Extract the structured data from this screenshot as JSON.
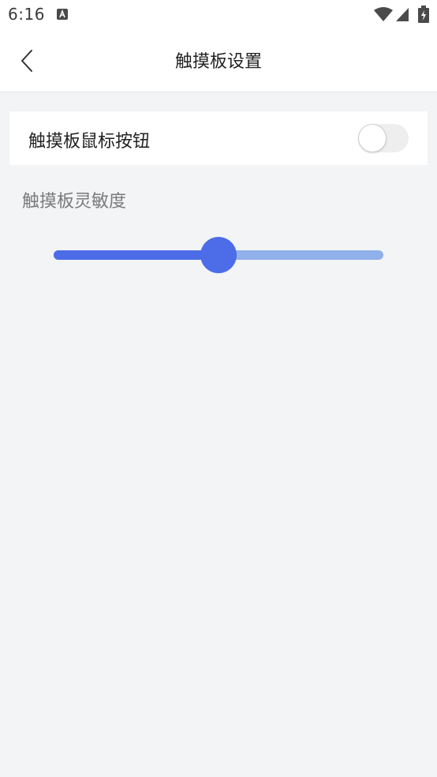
{
  "status_bar": {
    "time": "6:16",
    "icons": [
      "notification-a-icon",
      "wifi-icon",
      "cell-signal-icon",
      "battery-charging-icon"
    ]
  },
  "header": {
    "title": "触摸板设置",
    "back_icon": "chevron-left-icon"
  },
  "settings": {
    "mouse_button": {
      "label": "触摸板鼠标按钮",
      "enabled": false
    },
    "sensitivity": {
      "label": "触摸板灵敏度",
      "value_fraction": 0.5
    }
  },
  "colors": {
    "accent": "#4c6ce8",
    "track_remaining": "#8fb0e8",
    "background": "#f3f4f6",
    "toggle_off": "#eeeeee"
  }
}
